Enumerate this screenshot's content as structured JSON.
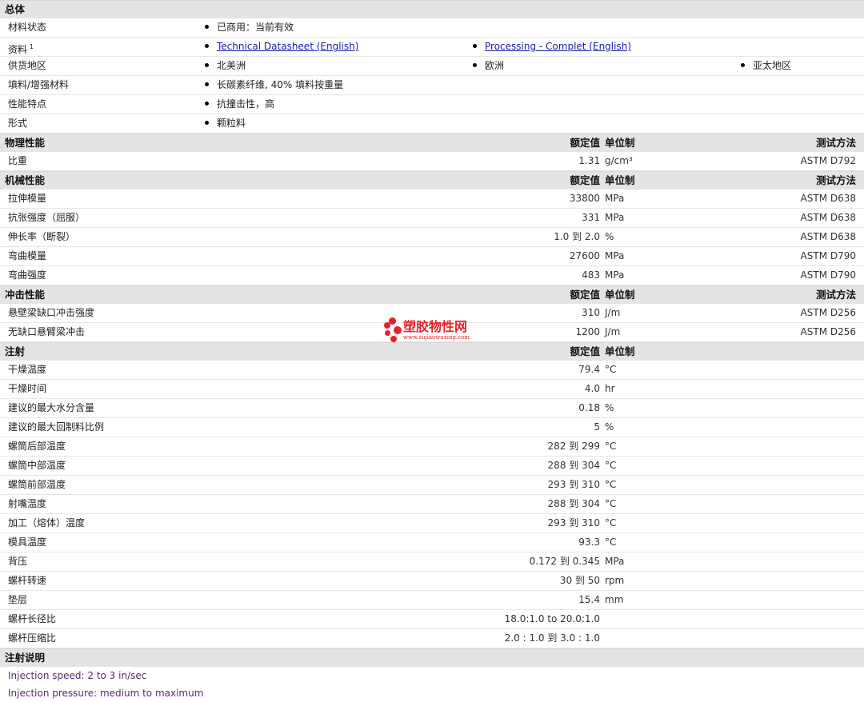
{
  "general": {
    "title": "总体",
    "status_label": "材料状态",
    "status_value": "已商用：当前有效",
    "docs_label": "资料",
    "docs_sup": "1",
    "doc_link_1": "Technical Datasheet (English)",
    "doc_link_2": "Processing - Complet (English)",
    "region_label": "供货地区",
    "region_1": "北美洲",
    "region_2": "欧洲",
    "region_3": "亚太地区",
    "filler_label": "填料/增强材料",
    "filler_value": "长碳素纤维, 40% 填料按重量",
    "feature_label": "性能特点",
    "feature_value": "抗撞击性，高",
    "form_label": "形式",
    "form_value": "颗粒料"
  },
  "col_headers": {
    "nominal": "额定值",
    "unit": "单位制",
    "test": "测试方法"
  },
  "physical": {
    "title": "物理性能",
    "rows": [
      {
        "label": "比重",
        "value": "1.31",
        "unit": "g/cm³",
        "test": "ASTM D792"
      }
    ]
  },
  "mechanical": {
    "title": "机械性能",
    "rows": [
      {
        "label": "拉伸模量",
        "value": "33800",
        "unit": "MPa",
        "test": "ASTM D638"
      },
      {
        "label": "抗张强度（屈服）",
        "value": "331",
        "unit": "MPa",
        "test": "ASTM D638"
      },
      {
        "label": "伸长率（断裂）",
        "value": "1.0 到  2.0",
        "unit": "%",
        "test": "ASTM D638"
      },
      {
        "label": "弯曲模量",
        "value": "27600",
        "unit": "MPa",
        "test": "ASTM D790"
      },
      {
        "label": "弯曲强度",
        "value": "483",
        "unit": "MPa",
        "test": "ASTM D790"
      }
    ]
  },
  "impact": {
    "title": "冲击性能",
    "rows": [
      {
        "label": "悬壁梁缺口冲击强度",
        "value": "310",
        "unit": "J/m",
        "test": "ASTM D256"
      },
      {
        "label": "无缺口悬臂梁冲击",
        "value": "1200",
        "unit": "J/m",
        "test": "ASTM D256"
      }
    ]
  },
  "injection": {
    "title": "注射",
    "rows": [
      {
        "label": "干燥温度",
        "value": "79.4",
        "unit": "°C"
      },
      {
        "label": "干燥时间",
        "value": "4.0",
        "unit": "hr"
      },
      {
        "label": "建议的最大水分含量",
        "value": "0.18",
        "unit": "%"
      },
      {
        "label": "建议的最大回制料比例",
        "value": "5",
        "unit": "%"
      },
      {
        "label": "螺筒后部温度",
        "value": "282 到  299",
        "unit": "°C"
      },
      {
        "label": "螺筒中部温度",
        "value": "288 到  304",
        "unit": "°C"
      },
      {
        "label": "螺筒前部温度",
        "value": "293 到  310",
        "unit": "°C"
      },
      {
        "label": "射嘴温度",
        "value": "288 到  304",
        "unit": "°C"
      },
      {
        "label": "加工（熔体）温度",
        "value": "293 到  310",
        "unit": "°C"
      },
      {
        "label": "模具温度",
        "value": "93.3",
        "unit": "°C"
      },
      {
        "label": "背压",
        "value": "0.172 到  0.345",
        "unit": "MPa"
      },
      {
        "label": "螺杆转速",
        "value": "30 到  50",
        "unit": "rpm"
      },
      {
        "label": "垫层",
        "value": "15.4",
        "unit": "mm"
      },
      {
        "label": "螺杆长径比",
        "value": "18.0:1.0 to 20.0:1.0",
        "unit": ""
      },
      {
        "label": "螺杆压缩比",
        "value": "2.0 : 1.0 到  3.0 : 1.0",
        "unit": ""
      }
    ]
  },
  "notes": {
    "title": "注射说明",
    "lines": [
      "Injection speed: 2 to 3 in/sec",
      "Injection pressure: medium to maximum"
    ]
  },
  "watermark": {
    "name": "塑胶物性网",
    "url": "www.sujiaowuxing.com",
    "color": "#e8202a"
  }
}
